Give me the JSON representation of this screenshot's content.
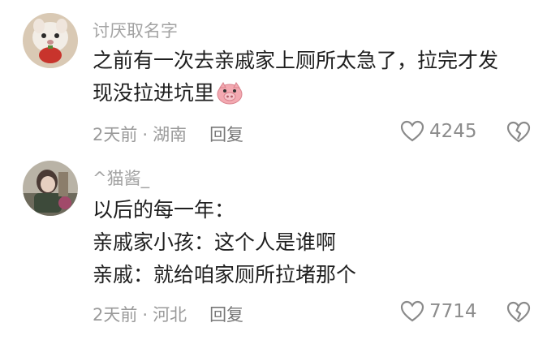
{
  "comments": [
    {
      "username": "讨厌取名字",
      "lines": [
        "之前有一次去亲戚家上厕所太急了，拉完才发",
        "现没拉进坑里"
      ],
      "emoji_icon": "pig-face-icon",
      "time": "2天前",
      "separator": "·",
      "location": "湖南",
      "reply_label": "回复",
      "likes": "4245",
      "like_icon": "heart-outline-icon",
      "dislike_icon": "broken-heart-icon"
    },
    {
      "username": "^猫酱_",
      "lines": [
        "以后的每一年：",
        "亲戚家小孩：这个人是谁啊",
        "亲戚：就给咱家厕所拉堵那个"
      ],
      "time": "2天前",
      "separator": "·",
      "location": "河北",
      "reply_label": "回复",
      "likes": "7714",
      "like_icon": "heart-outline-icon",
      "dislike_icon": "broken-heart-icon"
    }
  ],
  "colors": {
    "text": "#1f1f1f",
    "username": "#a3a3a3",
    "meta": "#9a9a9a",
    "pig": "#f3a9b1"
  }
}
